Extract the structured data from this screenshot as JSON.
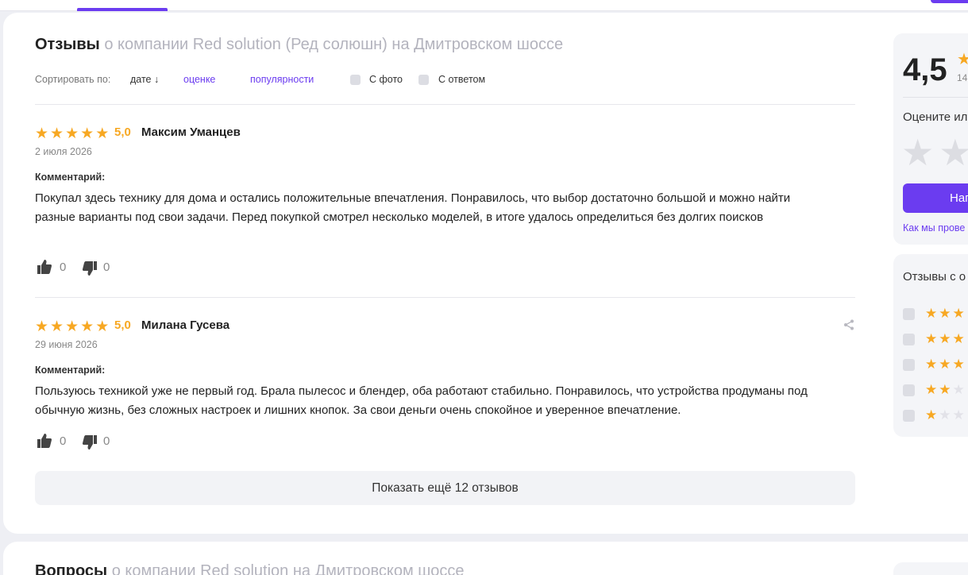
{
  "header": {
    "active_tab": ""
  },
  "reviews_section": {
    "title_bold": "Отзывы",
    "title_sub": "о компании Red solution (Ред солюшн) на Дмитровском шоссе",
    "sort": {
      "label": "Сортировать по:",
      "date": "дате ↓",
      "rating": "оценке",
      "popularity": "популярности"
    },
    "filters": {
      "photo": "С фото",
      "answer": "С ответом"
    },
    "comment_label": "Комментарий:",
    "reviews": [
      {
        "rating": 5,
        "score": "5,0",
        "author": "Максим Уманцев",
        "date": "2 июля 2026",
        "text": "Покупал здесь технику для дома и остались положительные впечатления. Понравилось, что выбор достаточно большой и можно найти разные варианты под свои задачи. Перед покупкой смотрел несколько моделей, в итоге удалось определиться без долгих поисков",
        "likes": "0",
        "dislikes": "0"
      },
      {
        "rating": 5,
        "score": "5,0",
        "author": "Милана Гусева",
        "date": "29 июня 2026",
        "text": "Пользуюсь техникой уже не первый год. Брала пылесос и блендер, оба работают стабильно. Понравилось, что устройства продуманы под обычную жизнь, без сложных настроек и лишних кнопок. За свои деньги очень спокойное и уверенное впечатление.",
        "likes": "0",
        "dislikes": "0"
      }
    ],
    "show_more": "Показать ещё 12 отзывов"
  },
  "questions_section": {
    "title_bold": "Вопросы",
    "title_sub": "о компании Red solution на Дмитровском шоссе"
  },
  "sidebar": {
    "score": "4,5",
    "count": "14",
    "rate_prompt": "Оцените ил",
    "rate_button": "Нап",
    "check_link": "Как мы прове",
    "filter_title": "Отзывы с о",
    "filter_levels": [
      5,
      4,
      3,
      2,
      1
    ]
  },
  "colors": {
    "accent": "#6b3cf0",
    "star": "#f7a823",
    "star_off": "#dedee4"
  }
}
